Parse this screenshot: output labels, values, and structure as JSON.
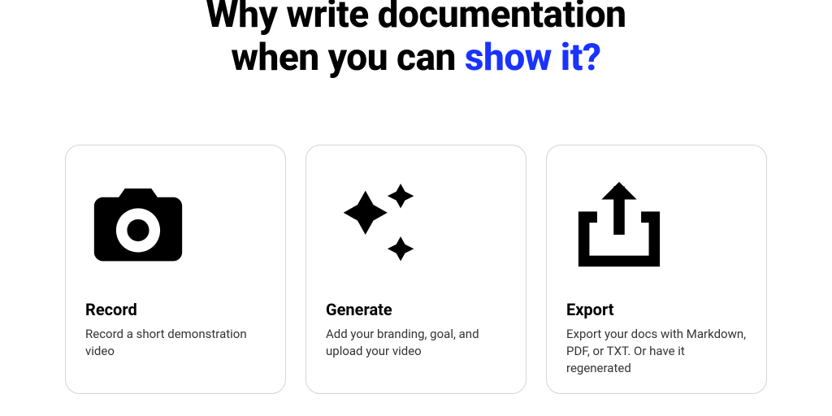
{
  "heading": {
    "part1": "Why write documentation",
    "part2": "when you can ",
    "accent": "show it?"
  },
  "cards": [
    {
      "title": "Record",
      "desc": "Record a short demonstration video"
    },
    {
      "title": "Generate",
      "desc": "Add your branding, goal, and upload your video"
    },
    {
      "title": "Export",
      "desc": "Export your docs with Markdown, PDF, or TXT. Or have it regenerated"
    }
  ]
}
